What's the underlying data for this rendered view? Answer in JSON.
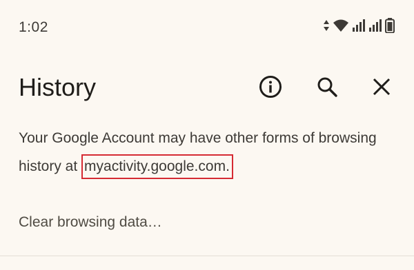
{
  "status_bar": {
    "time": "1:02",
    "icons": [
      "data-activity-icon",
      "wifi-icon",
      "signal-icon",
      "signal-icon",
      "battery-icon"
    ]
  },
  "app_bar": {
    "title": "History",
    "actions": [
      "info-icon",
      "search-icon",
      "close-icon"
    ]
  },
  "account_message": {
    "text": "Your Google Account may have other forms of browsing history at ",
    "link": "myactivity.google.com",
    "suffix": "."
  },
  "clear_browsing": {
    "label": "Clear browsing data…"
  },
  "colors": {
    "background": "#fcf8f2",
    "text": "#1f1d1a",
    "highlight_box": "#d52a32"
  }
}
